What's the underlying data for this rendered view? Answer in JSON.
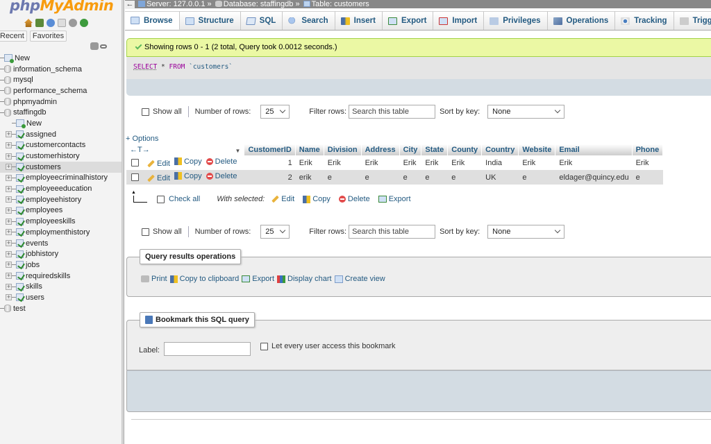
{
  "app": {
    "logo_php": "php",
    "logo_myadmin": "MyAdmin"
  },
  "sidebar": {
    "nav_icons": [
      "home-icon",
      "logout-icon",
      "help-icon",
      "docs-icon",
      "settings-icon",
      "reload-icon"
    ],
    "tabs": [
      "Recent",
      "Favorites"
    ],
    "tree": [
      {
        "label": "New",
        "type": "new",
        "level": 0
      },
      {
        "label": "information_schema",
        "type": "db",
        "level": 0
      },
      {
        "label": "mysql",
        "type": "db",
        "level": 0
      },
      {
        "label": "performance_schema",
        "type": "db",
        "level": 0
      },
      {
        "label": "phpmyadmin",
        "type": "db",
        "level": 0
      },
      {
        "label": "staffingdb",
        "type": "db",
        "level": 0
      },
      {
        "label": "New",
        "type": "new",
        "level": 1
      },
      {
        "label": "assigned",
        "type": "table",
        "level": 1
      },
      {
        "label": "customercontacts",
        "type": "table",
        "level": 1
      },
      {
        "label": "customerhistory",
        "type": "table",
        "level": 1
      },
      {
        "label": "customers",
        "type": "table",
        "level": 1,
        "selected": true
      },
      {
        "label": "employeecriminalhistory",
        "type": "table",
        "level": 1
      },
      {
        "label": "employeeeducation",
        "type": "table",
        "level": 1
      },
      {
        "label": "employeehistory",
        "type": "table",
        "level": 1
      },
      {
        "label": "employees",
        "type": "table",
        "level": 1
      },
      {
        "label": "employeeskills",
        "type": "table",
        "level": 1
      },
      {
        "label": "employmenthistory",
        "type": "table",
        "level": 1
      },
      {
        "label": "events",
        "type": "table",
        "level": 1
      },
      {
        "label": "jobhistory",
        "type": "table",
        "level": 1
      },
      {
        "label": "jobs",
        "type": "table",
        "level": 1
      },
      {
        "label": "requiredskills",
        "type": "table",
        "level": 1
      },
      {
        "label": "skills",
        "type": "table",
        "level": 1
      },
      {
        "label": "users",
        "type": "table",
        "level": 1
      },
      {
        "label": "test",
        "type": "db",
        "level": 0
      }
    ]
  },
  "breadcrumb": {
    "back": "←",
    "server": "Server: 127.0.0.1",
    "database": "Database: staffingdb",
    "table": "Table: customers",
    "sep": "»"
  },
  "tabs": [
    {
      "label": "Browse",
      "icon": "ti-browse",
      "active": true
    },
    {
      "label": "Structure",
      "icon": "ti-struct"
    },
    {
      "label": "SQL",
      "icon": "ti-sql"
    },
    {
      "label": "Search",
      "icon": "ti-search"
    },
    {
      "label": "Insert",
      "icon": "ti-insert"
    },
    {
      "label": "Export",
      "icon": "ti-export"
    },
    {
      "label": "Import",
      "icon": "ti-import"
    },
    {
      "label": "Privileges",
      "icon": "ti-priv"
    },
    {
      "label": "Operations",
      "icon": "ti-ops"
    },
    {
      "label": "Tracking",
      "icon": "ti-track"
    },
    {
      "label": "Triggers",
      "icon": "ti-trig"
    }
  ],
  "message": "Showing rows 0 - 1 (2 total, Query took 0.0012 seconds.)",
  "sql": {
    "select": "SELECT",
    "star": " * ",
    "from": "FROM",
    "table": " `customers`"
  },
  "nav": {
    "show_all": "Show all",
    "number_of_rows_label": "Number of rows:",
    "number_of_rows_value": "25",
    "filter_label": "Filter rows:",
    "filter_placeholder": "Search this table",
    "sort_label": "Sort by key:",
    "sort_value": "None"
  },
  "options_link": "+ Options",
  "table": {
    "arrows": "←T→",
    "columns": [
      "CustomerID",
      "Name",
      "Division",
      "Address",
      "City",
      "State",
      "County",
      "Country",
      "Website",
      "Email",
      "Phone"
    ],
    "row_actions": {
      "edit": "Edit",
      "copy": "Copy",
      "delete": "Delete"
    },
    "rows": [
      [
        "1",
        "Erik",
        "Erik",
        "Erik",
        "Erik",
        "Erik",
        "Erik",
        "India",
        "Erik",
        "Erik",
        "Erik"
      ],
      [
        "2",
        "erik",
        "e",
        "e",
        "e",
        "e",
        "e",
        "UK",
        "e",
        "eldager@quincy.edu",
        "e"
      ]
    ]
  },
  "bulk": {
    "check_all": "Check all",
    "with_selected": "With selected:",
    "edit": "Edit",
    "copy": "Copy",
    "delete": "Delete",
    "export": "Export"
  },
  "query_ops": {
    "legend": "Query results operations",
    "print": "Print",
    "copy_clipboard": "Copy to clipboard",
    "export": "Export",
    "display_chart": "Display chart",
    "create_view": "Create view"
  },
  "bookmark": {
    "legend": "Bookmark this SQL query",
    "label": "Label:",
    "label_value": "",
    "share": "Let every user access this bookmark"
  }
}
